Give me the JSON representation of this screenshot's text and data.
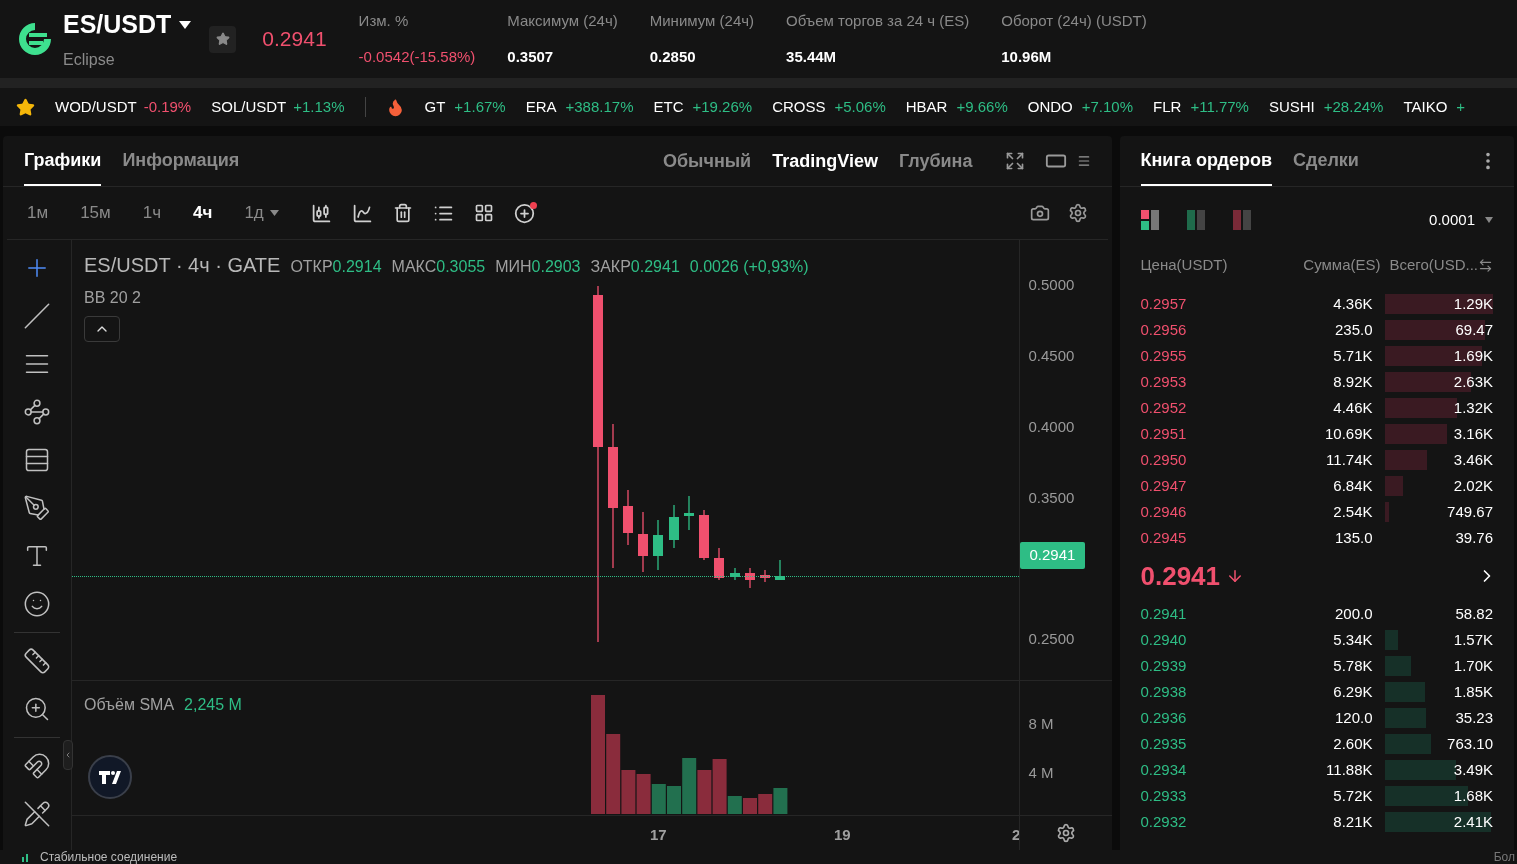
{
  "header": {
    "pair": "ES/USDT",
    "name": "Eclipse",
    "price": "0.2941",
    "stats": [
      {
        "label": "Изм. %",
        "value": "-0.0542(-15.58%)",
        "color": "#f0506e"
      },
      {
        "label": "Максимум (24ч)",
        "value": "0.3507",
        "color": "#ffffff"
      },
      {
        "label": "Минимум (24ч)",
        "value": "0.2850",
        "color": "#ffffff"
      },
      {
        "label": "Объем торгов за 24 ч (ES)",
        "value": "35.44M",
        "color": "#ffffff"
      },
      {
        "label": "Оборот (24ч) (USDT)",
        "value": "10.96M",
        "color": "#ffffff"
      }
    ]
  },
  "ticker": {
    "favorites": [
      {
        "symbol": "WOD/USDT",
        "change": "-0.19%",
        "color": "#f0506e"
      },
      {
        "symbol": "SOL/USDT",
        "change": "+1.13%",
        "color": "#2ebd85"
      }
    ],
    "hot": [
      {
        "symbol": "GT",
        "change": "+1.67%",
        "color": "#2ebd85"
      },
      {
        "symbol": "ERA",
        "change": "+388.17%",
        "color": "#2ebd85"
      },
      {
        "symbol": "ETC",
        "change": "+19.26%",
        "color": "#2ebd85"
      },
      {
        "symbol": "CROSS",
        "change": "+5.06%",
        "color": "#2ebd85"
      },
      {
        "symbol": "HBAR",
        "change": "+9.66%",
        "color": "#2ebd85"
      },
      {
        "symbol": "ONDO",
        "change": "+7.10%",
        "color": "#2ebd85"
      },
      {
        "symbol": "FLR",
        "change": "+11.77%",
        "color": "#2ebd85"
      },
      {
        "symbol": "SUSHI",
        "change": "+28.24%",
        "color": "#2ebd85"
      },
      {
        "symbol": "TAIKO",
        "change": "+",
        "color": "#2ebd85"
      }
    ]
  },
  "chart_panel": {
    "tabs": [
      {
        "label": "Графики",
        "selected": true
      },
      {
        "label": "Информация",
        "selected": false
      }
    ],
    "views": [
      {
        "label": "Обычный",
        "selected": false
      },
      {
        "label": "TradingView",
        "selected": true
      },
      {
        "label": "Глубина",
        "selected": false
      }
    ],
    "intervals": [
      {
        "label": "1м",
        "selected": false,
        "dropdown": false
      },
      {
        "label": "15м",
        "selected": false,
        "dropdown": false
      },
      {
        "label": "1ч",
        "selected": false,
        "dropdown": false
      },
      {
        "label": "4ч",
        "selected": true,
        "dropdown": false
      },
      {
        "label": "1д",
        "selected": false,
        "dropdown": true
      }
    ],
    "legend": {
      "title": "ES/USDT · 4ч · GATE",
      "fields": [
        {
          "label": "ОТКР",
          "value": "0.2914"
        },
        {
          "label": "МАКС",
          "value": "0.3055"
        },
        {
          "label": "МИН",
          "value": "0.2903"
        },
        {
          "label": "ЗАКР",
          "value": "0.2941"
        }
      ],
      "change": "0.0026 (+0,93%)",
      "indicator": "BB 20 2"
    },
    "price_axis": [
      "0.5000",
      "0.4500",
      "0.4000",
      "0.3500",
      "0.2500"
    ],
    "current_price": "0.2941",
    "volume": {
      "label": "Объём SMA",
      "value": "2,245 M"
    },
    "volume_axis": [
      "8 M",
      "4 M"
    ],
    "time_axis": [
      "17",
      "19",
      "2"
    ]
  },
  "order_book": {
    "tabs": [
      {
        "label": "Книга ордеров",
        "selected": true
      },
      {
        "label": "Сделки",
        "selected": false
      }
    ],
    "step": "0.0001",
    "columns": [
      "Цена(USDT)",
      "Сумма(ES)",
      "Всего(USD..."
    ],
    "asks": [
      {
        "price": "0.2957",
        "amount": "4.36K",
        "total": "1.29K"
      },
      {
        "price": "0.2956",
        "amount": "235.0",
        "total": "69.47"
      },
      {
        "price": "0.2955",
        "amount": "5.71K",
        "total": "1.69K"
      },
      {
        "price": "0.2953",
        "amount": "8.92K",
        "total": "2.63K"
      },
      {
        "price": "0.2952",
        "amount": "4.46K",
        "total": "1.32K"
      },
      {
        "price": "0.2951",
        "amount": "10.69K",
        "total": "3.16K"
      },
      {
        "price": "0.2950",
        "amount": "11.74K",
        "total": "3.46K"
      },
      {
        "price": "0.2947",
        "amount": "6.84K",
        "total": "2.02K"
      },
      {
        "price": "0.2946",
        "amount": "2.54K",
        "total": "749.67"
      },
      {
        "price": "0.2945",
        "amount": "135.0",
        "total": "39.76"
      }
    ],
    "last_price": {
      "value": "0.2941",
      "color": "#f0506e"
    },
    "bids": [
      {
        "price": "0.2941",
        "amount": "200.0",
        "total": "58.82"
      },
      {
        "price": "0.2940",
        "amount": "5.34K",
        "total": "1.57K"
      },
      {
        "price": "0.2939",
        "amount": "5.78K",
        "total": "1.70K"
      },
      {
        "price": "0.2938",
        "amount": "6.29K",
        "total": "1.85K"
      },
      {
        "price": "0.2936",
        "amount": "120.0",
        "total": "35.23"
      },
      {
        "price": "0.2935",
        "amount": "2.60K",
        "total": "763.10"
      },
      {
        "price": "0.2934",
        "amount": "11.88K",
        "total": "3.49K"
      },
      {
        "price": "0.2933",
        "amount": "5.72K",
        "total": "1.68K"
      },
      {
        "price": "0.2932",
        "amount": "8.21K",
        "total": "2.41K"
      }
    ],
    "more": "Бол"
  },
  "status_bar": {
    "connection": "Стабильное соединение"
  }
}
